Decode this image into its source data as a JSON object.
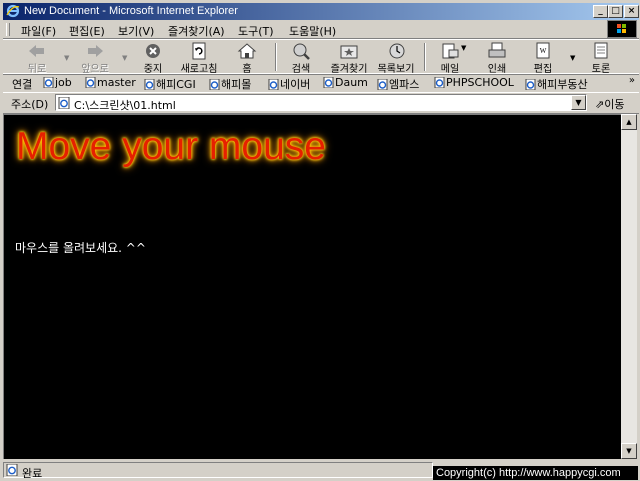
{
  "window": {
    "title": "New Document - Microsoft Internet Explorer"
  },
  "titlebar_buttons": {
    "minimize": "_",
    "maximize": "□",
    "close": "×"
  },
  "menu": [
    "파일(F)",
    "편집(E)",
    "보기(V)",
    "즐겨찾기(A)",
    "도구(T)",
    "도움말(H)"
  ],
  "toolbar": {
    "back": "뒤로",
    "forward": "앞으로",
    "stop": "중지",
    "refresh": "새로고침",
    "home": "홈",
    "search": "검색",
    "favorites": "즐겨찾기",
    "history": "목록보기",
    "mail": "메일",
    "print": "인쇄",
    "edit": "편집",
    "discuss": "토론"
  },
  "links": {
    "label": "연결",
    "items": [
      "job",
      "master",
      "해피CGI",
      "해피몰",
      "네이버",
      "Daum",
      "엠파스",
      "PHPSCHOOL",
      "해피부동산"
    ]
  },
  "address": {
    "label": "주소(D)",
    "url": "C:\\스크린샷\\01.html",
    "go": "이동"
  },
  "page": {
    "headline": "Move your mouse",
    "text": "마우스를 올려보세요. ^^"
  },
  "status": {
    "text": "완료"
  },
  "overlay": {
    "copyright": "Copyright(c) http://www.happycgi.com"
  }
}
